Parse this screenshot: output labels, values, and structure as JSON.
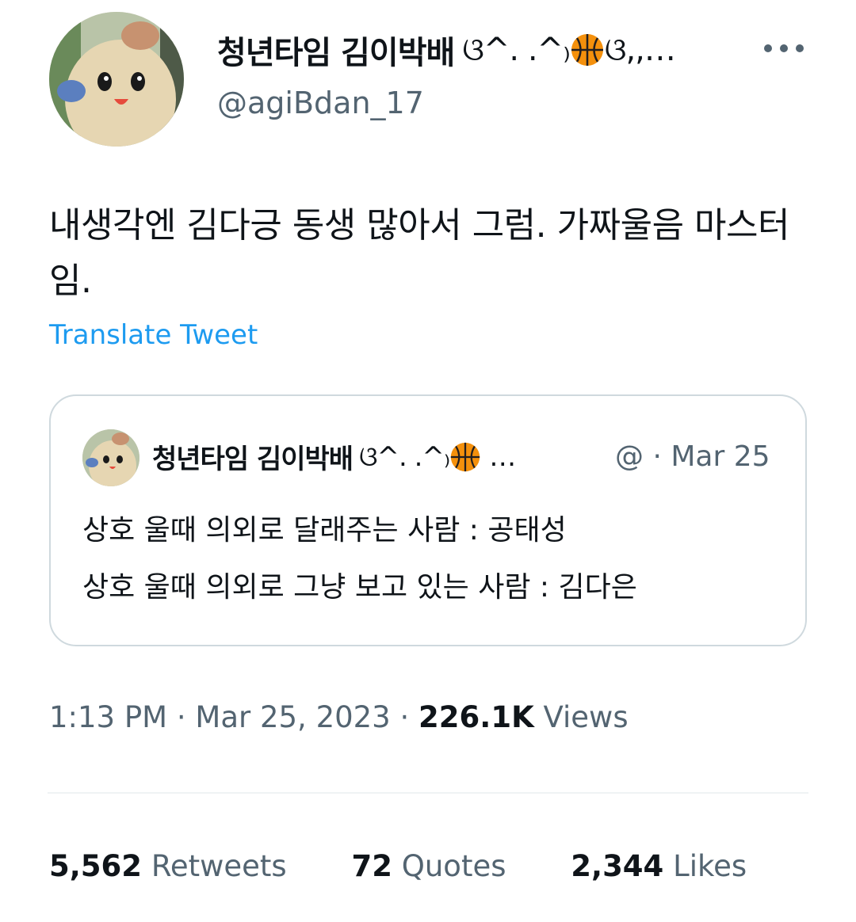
{
  "author": {
    "display_name": "청년타임 김이박배",
    "display_name_suffix": "ଓ^. .^₎",
    "display_name_end": "ଓ,,…",
    "handle": "@agiBdan_17"
  },
  "tweet": {
    "text": "내생각엔 김다긍 동생 많아서 그럼. 가짜울음 마스터임.",
    "translate_label": "Translate Tweet"
  },
  "quoted_tweet": {
    "display_name": "청년타임 김이박배",
    "display_name_suffix": "ଓ^. .^₎",
    "ellipsis": "…",
    "handle": "@",
    "separator": "·",
    "date": "Mar 25",
    "line1": "상호 울때 의외로 달래주는 사람 : 공태성",
    "line2": "상호 울때 의외로 그냥 보고 있는 사람 : 김다은"
  },
  "meta": {
    "time": "1:13 PM",
    "separator": "·",
    "date": "Mar 25, 2023",
    "views_count": "226.1K",
    "views_label": "Views"
  },
  "stats": {
    "retweets_count": "5,562",
    "retweets_label": "Retweets",
    "quotes_count": "72",
    "quotes_label": "Quotes",
    "likes_count": "2,344",
    "likes_label": "Likes"
  },
  "icons": {
    "more": "more-horizontal-icon",
    "basketball": "basketball-icon"
  },
  "colors": {
    "link": "#1d9bf0",
    "secondary_text": "#536471",
    "border": "#cfd9de",
    "basketball": "#f4900c"
  }
}
